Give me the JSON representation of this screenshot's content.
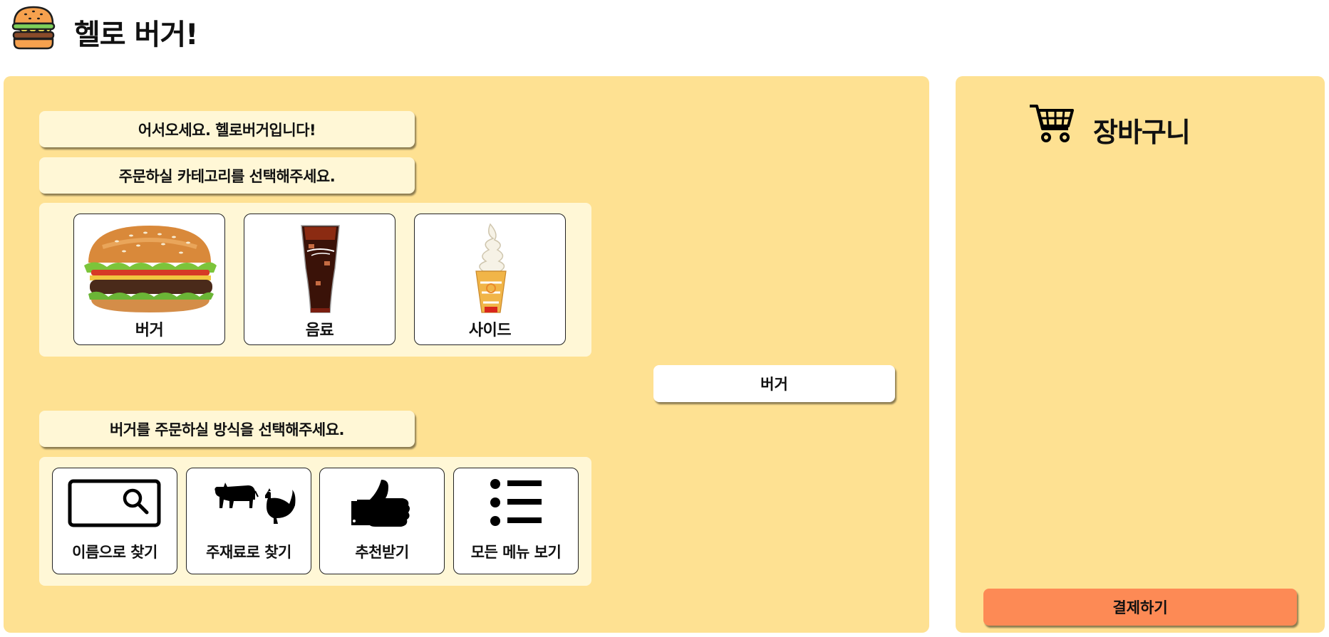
{
  "header": {
    "title": "헬로 버거!",
    "logo_icon": "burger-logo-icon"
  },
  "main": {
    "greeting": "어서오세요. 헬로버거입니다!",
    "category_prompt": "주문하실 카테고리를 선택해주세요.",
    "categories": [
      {
        "label": "버거",
        "icon": "burger-image"
      },
      {
        "label": "음료",
        "icon": "cola-cup-image"
      },
      {
        "label": "사이드",
        "icon": "ice-cream-cone-image"
      }
    ],
    "selected_category": "버거",
    "method_prompt": "버거를 주문하실 방식을 선택해주세요.",
    "methods": [
      {
        "label": "이름으로 찾기",
        "icon": "search-box-icon"
      },
      {
        "label": "주재료로 찾기",
        "icon": "cow-chicken-icon"
      },
      {
        "label": "추천받기",
        "icon": "thumbs-up-icon"
      },
      {
        "label": "모든 메뉴 보기",
        "icon": "list-icon"
      }
    ]
  },
  "cart": {
    "title": "장바구니",
    "icon": "shopping-cart-icon",
    "checkout_label": "결제하기"
  },
  "colors": {
    "panel": "#fee192",
    "bubble": "#fff7d6",
    "checkout": "#fd8a55"
  }
}
